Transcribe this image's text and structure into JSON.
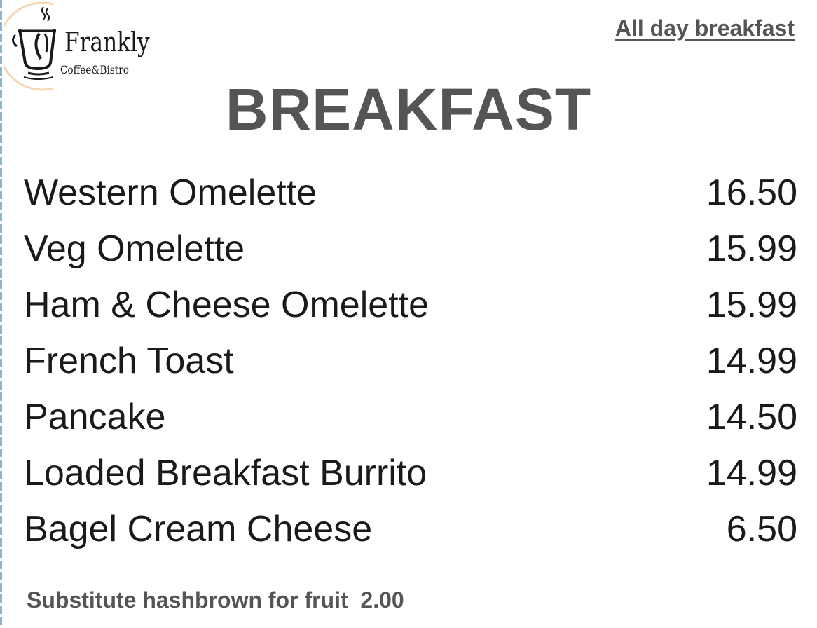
{
  "logo": {
    "icon": "coffee-cup-icon",
    "name": "Frankly",
    "subtitle": "Coffee&Bistro",
    "ring_color": "#f2d9b3"
  },
  "header": {
    "tagline": "All day breakfast",
    "title": "BREAKFAST"
  },
  "menu": {
    "items": [
      {
        "name": "Western Omelette",
        "price": "16.50"
      },
      {
        "name": "Veg Omelette",
        "price": "15.99"
      },
      {
        "name": "Ham & Cheese Omelette",
        "price": "15.99"
      },
      {
        "name": "French Toast",
        "price": "14.99"
      },
      {
        "name": "Pancake",
        "price": "14.50"
      },
      {
        "name": "Loaded Breakfast Burrito",
        "price": "14.99"
      },
      {
        "name": "Bagel Cream Cheese",
        "price": "6.50"
      }
    ]
  },
  "footer": {
    "note": "Substitute hashbrown for fruit  2.00"
  },
  "colors": {
    "heading_gray": "#555555",
    "text_dark": "#1a1a1a",
    "border_blue": "#8fb3c9"
  }
}
